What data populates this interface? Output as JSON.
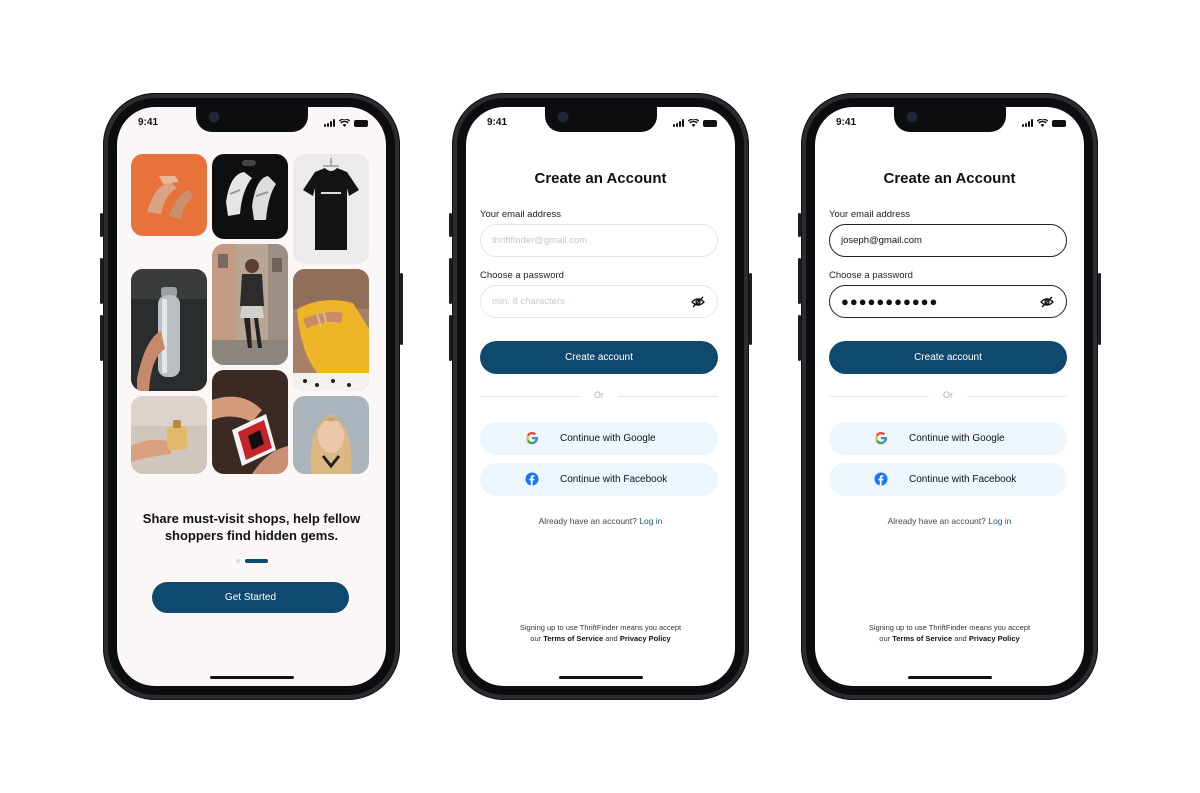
{
  "status_bar": {
    "time": "9:41"
  },
  "onboarding": {
    "headline": "Share must-visit shops, help fellow shoppers find hidden gems.",
    "cta_label": "Get Started",
    "carousel": {
      "current_page": 2,
      "total_pages": 2
    },
    "photos": [
      "shoes-photo",
      "sneakers-photo",
      "tshirt-photo",
      "bottle-photo",
      "street-fashion-photo",
      "jewelry-photo",
      "perfume-photo",
      "cards-photo",
      "doll-photo"
    ]
  },
  "signup_empty": {
    "title": "Create an Account",
    "email_label": "Your email address",
    "email_placeholder": "thriftfinder@gmail.com",
    "password_label": "Choose a password",
    "password_placeholder": "min. 8 characters",
    "create_label": "Create account",
    "or_text": "Or",
    "google_label": "Continue with Google",
    "facebook_label": "Continue with Facebook",
    "login_prompt": "Already have an account?",
    "login_link": "Log in",
    "legal_line1": "Signing up to use ThriftFinder means you accept",
    "legal_our": "our",
    "legal_terms": "Terms of Service",
    "legal_and": "and",
    "legal_privacy": "Privacy Policy"
  },
  "signup_filled": {
    "title": "Create an Account",
    "email_label": "Your email address",
    "email_value": "joseph@gmail.com",
    "password_label": "Choose a password",
    "password_value": "●●●●●●●●●●●",
    "create_label": "Create account",
    "or_text": "Or",
    "google_label": "Continue with Google",
    "facebook_label": "Continue with Facebook",
    "login_prompt": "Already have an account?",
    "login_link": "Log in",
    "legal_line1": "Signing up to use ThriftFinder means you accept",
    "legal_our": "our",
    "legal_terms": "Terms of Service",
    "legal_and": "and",
    "legal_privacy": "Privacy Policy"
  },
  "colors": {
    "primary": "#0f4a6e",
    "social_bg": "#eef6fd",
    "link": "#1d5a8a",
    "onboard_bg": "#faf7f6"
  }
}
